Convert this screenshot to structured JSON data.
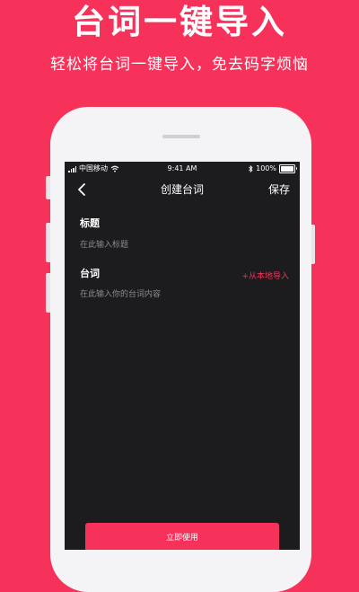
{
  "promo": {
    "headline": "台词一键导入",
    "subline": "轻松将台词一键导入，免去码字烦恼"
  },
  "status_bar": {
    "carrier": "中国移动",
    "time": "9:41 AM",
    "battery": "100%"
  },
  "nav": {
    "title": "创建台词",
    "save_label": "保存"
  },
  "form": {
    "title_label": "标题",
    "title_placeholder": "在此输入标题",
    "lines_label": "台词",
    "lines_placeholder": "在此输入你的台词内容",
    "import_label": "+从本地导入"
  },
  "footer": {
    "use_button": "立即使用"
  },
  "colors": {
    "accent": "#f6325a",
    "screen_bg": "#1c1c1e"
  }
}
